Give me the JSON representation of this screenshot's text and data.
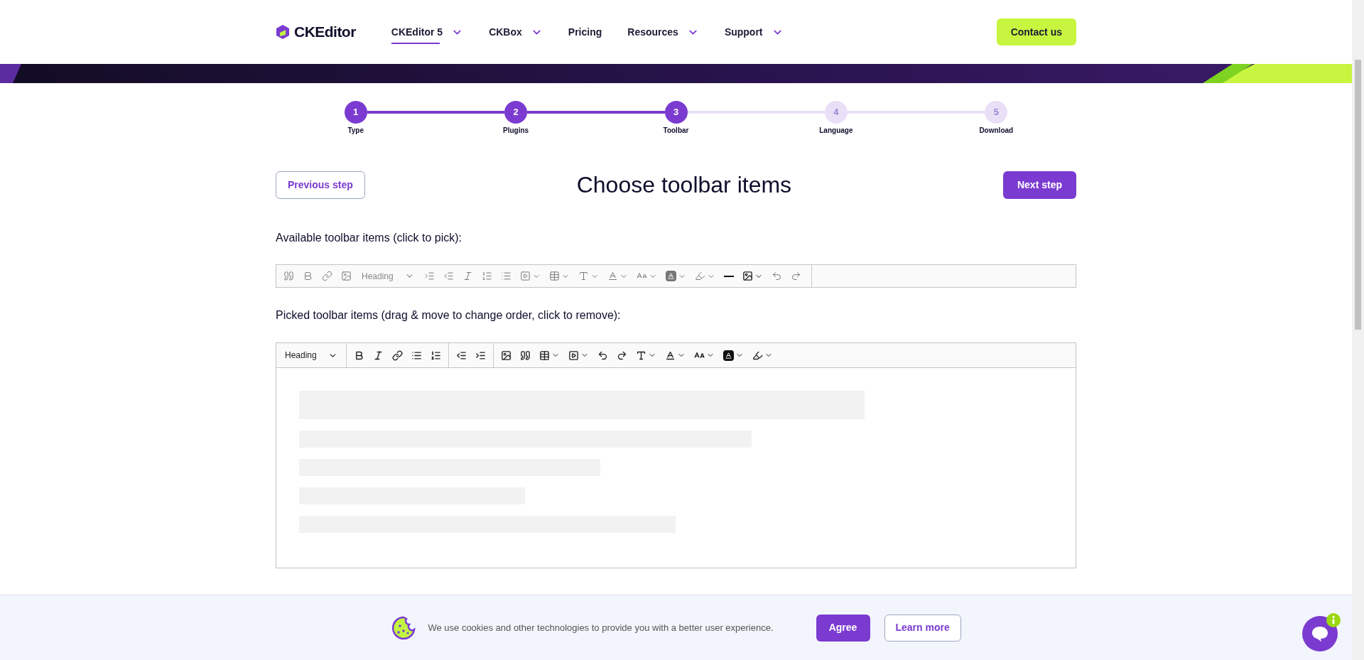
{
  "header": {
    "logo": "CKEditor",
    "nav": [
      {
        "label": "CKEditor 5",
        "dropdown": true,
        "selected": true
      },
      {
        "label": "CKBox",
        "dropdown": true,
        "selected": false
      },
      {
        "label": "Pricing",
        "dropdown": false,
        "selected": false
      },
      {
        "label": "Resources",
        "dropdown": true,
        "selected": false
      },
      {
        "label": "Support",
        "dropdown": true,
        "selected": false
      }
    ],
    "cta": "Contact us"
  },
  "steps": [
    {
      "number": "1",
      "label": "Type",
      "active": true
    },
    {
      "number": "2",
      "label": "Plugins",
      "active": true
    },
    {
      "number": "3",
      "label": "Toolbar",
      "active": true
    },
    {
      "number": "4",
      "label": "Language",
      "active": false
    },
    {
      "number": "5",
      "label": "Download",
      "active": false
    }
  ],
  "title": "Choose toolbar items",
  "previous": "Previous step",
  "next": "Next step",
  "available": {
    "label": "Available toolbar items (click to pick):",
    "heading": "Heading"
  },
  "picked": {
    "label": "Picked toolbar items (drag & move to change order, click to remove):",
    "heading": "Heading"
  },
  "cookie": {
    "text": "We use cookies and other technologies to provide you with a better user experience.",
    "agree": "Agree",
    "learn": "Learn more"
  }
}
